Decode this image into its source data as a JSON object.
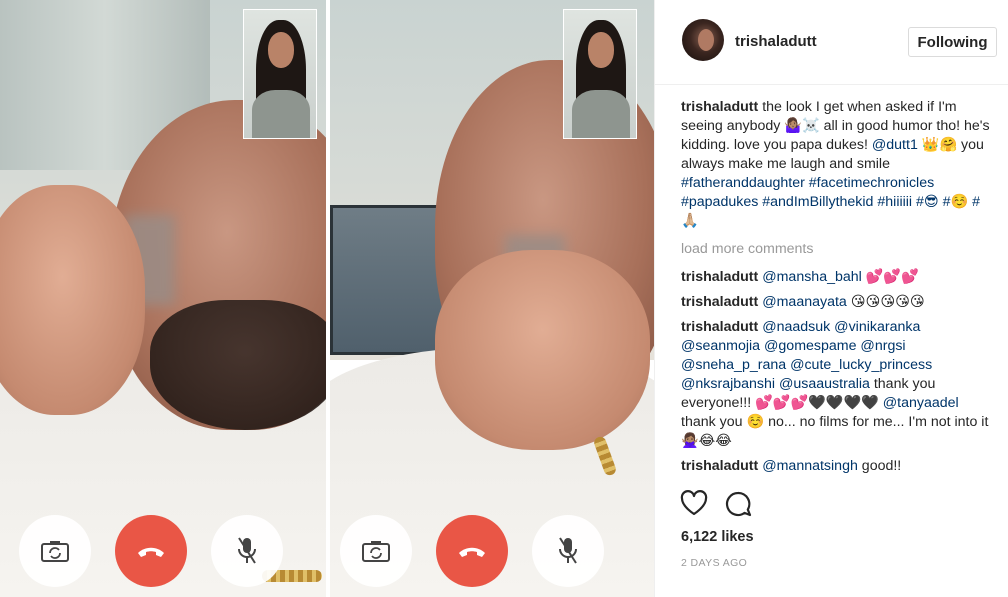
{
  "post": {
    "left_panel_label": "FaceTime call screenshot - left",
    "right_panel_label": "FaceTime call screenshot - right"
  },
  "sidebar": {
    "username": "trishaladutt",
    "follow_label": "Following",
    "caption": {
      "author": "trishaladutt",
      "text_1": " the look I get when asked if I'm seeing anybody 🤷🏽‍♀️☠️ all in good humor tho! he's kidding. love you papa dukes! ",
      "mention_1": "@dutt1",
      "text_2": " 👑🤗 you always make me laugh and smile ",
      "tags": "#fatheranddaughter #facetimechronicles #papadukes #andImBillythekid #hiiiiii #😎 #☺️ #🙏🏼"
    },
    "load_more": "load more comments",
    "comments": [
      {
        "author": "trishaladutt",
        "link": "@mansha_bahl",
        "text": " 💕💕💕"
      },
      {
        "author": "trishaladutt",
        "link": "@maanayata",
        "text": " 😘😘😘😘😘"
      },
      {
        "author": "trishaladutt",
        "link": "@naadsuk @vinikaranka @seanmojia @gomespame @nrgsi @sneha_p_rana @cute_lucky_princess @nksrajbanshi @usaaustralia",
        "text": " thank you everyone!!! 💕💕💕🖤🖤🖤🖤 ",
        "link_2": "@tanyaadel",
        "text_2": " thank you ☺️ no... no films for me... I'm not into it 🙅🏽‍♀️😂😂"
      },
      {
        "author": "trishaladutt",
        "link": "@mannatsingh",
        "text": " good!!"
      }
    ],
    "likes": "6,122 likes",
    "timestamp": "2 DAYS AGO",
    "icons": {
      "like": "heart-icon",
      "comment": "comment-bubble-icon"
    }
  },
  "colors": {
    "end_call": "#e95646",
    "link": "#003569",
    "muted": "#999999",
    "text": "#262626"
  }
}
